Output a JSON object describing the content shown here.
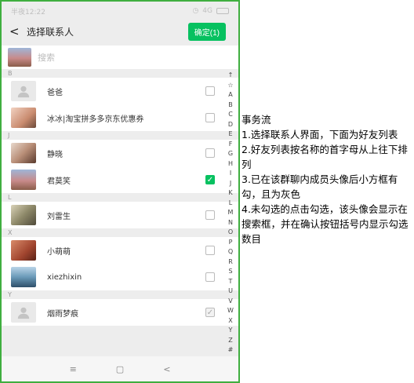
{
  "status_bar": {
    "time": "半夜12:22",
    "network": "4G"
  },
  "topbar": {
    "back_icon": "chevron-left-icon",
    "title": "选择联系人",
    "confirm_label": "确定(1)"
  },
  "search": {
    "placeholder": "搜索"
  },
  "sections": [
    {
      "letter": "B",
      "contacts": [
        {
          "name": "爸爸",
          "avatar": "default",
          "checkbox": "unchecked"
        },
        {
          "name": "冰冰|淘宝拼多多京东优惠券",
          "avatar": "photo",
          "checkbox": "unchecked"
        }
      ]
    },
    {
      "letter": "J",
      "contacts": [
        {
          "name": "静晓",
          "avatar": "photo",
          "checkbox": "unchecked"
        },
        {
          "name": "君莫笑",
          "avatar": "photo",
          "checkbox": "checked"
        }
      ]
    },
    {
      "letter": "L",
      "contacts": [
        {
          "name": "刘雷生",
          "avatar": "photo",
          "checkbox": "unchecked"
        }
      ]
    },
    {
      "letter": "X",
      "contacts": [
        {
          "name": "小萌萌",
          "avatar": "photo",
          "checkbox": "unchecked"
        },
        {
          "name": "xiezhixin",
          "avatar": "photo",
          "checkbox": "unchecked"
        }
      ]
    },
    {
      "letter": "Y",
      "contacts": [
        {
          "name": "烟雨梦痕",
          "avatar": "default",
          "checkbox": "disabled-checked"
        }
      ]
    }
  ],
  "index_bar": [
    "↑",
    "☆",
    "A",
    "B",
    "C",
    "D",
    "E",
    "F",
    "G",
    "H",
    "I",
    "J",
    "K",
    "L",
    "M",
    "N",
    "O",
    "P",
    "Q",
    "R",
    "S",
    "T",
    "U",
    "V",
    "W",
    "X",
    "Y",
    "Z",
    "#"
  ],
  "nav_bar": {
    "menu": "≡",
    "home": "▢",
    "back": "<"
  },
  "notes": {
    "heading": "事务流",
    "items": [
      "1.选择联系人界面，下面为好友列表",
      "2.好友列表按名称的首字母从上往下排列",
      "3.已在该群聊内成员头像后小方框有勾，且为灰色",
      "4.未勾选的点击勾选，该头像会显示在搜索框，并在确认按钮括号内显示勾选数目"
    ]
  },
  "colors": {
    "accent": "#07c160",
    "frame": "#3fae3f"
  }
}
